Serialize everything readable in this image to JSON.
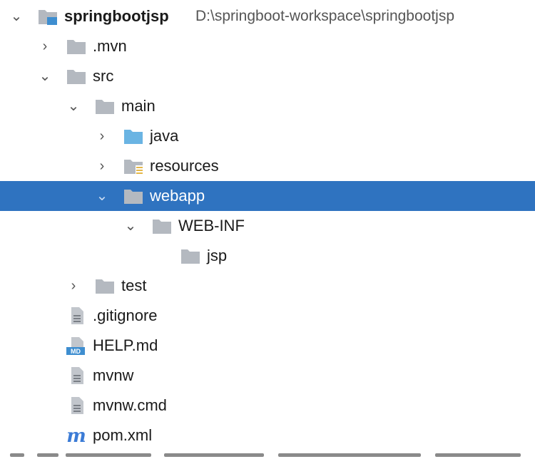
{
  "project": {
    "name": "springbootjsp",
    "path": "D:\\springboot-workspace\\springbootjsp"
  },
  "nodes": {
    "mvn": ".mvn",
    "src": "src",
    "main": "main",
    "java": "java",
    "resources": "resources",
    "webapp": "webapp",
    "webinf": "WEB-INF",
    "jsp": "jsp",
    "test": "test",
    "gitignore": ".gitignore",
    "help": "HELP.md",
    "help_badge": "MD",
    "mvnw": "mvnw",
    "mvnwcmd": "mvnw.cmd",
    "pom": "pom.xml",
    "pom_badge": "m"
  },
  "colors": {
    "selection": "#2f73c0",
    "folder": "#b4b9c0",
    "source_folder": "#6ab4e3",
    "resource_marker": "#e5b84a",
    "maven": "#3b7bd6"
  }
}
